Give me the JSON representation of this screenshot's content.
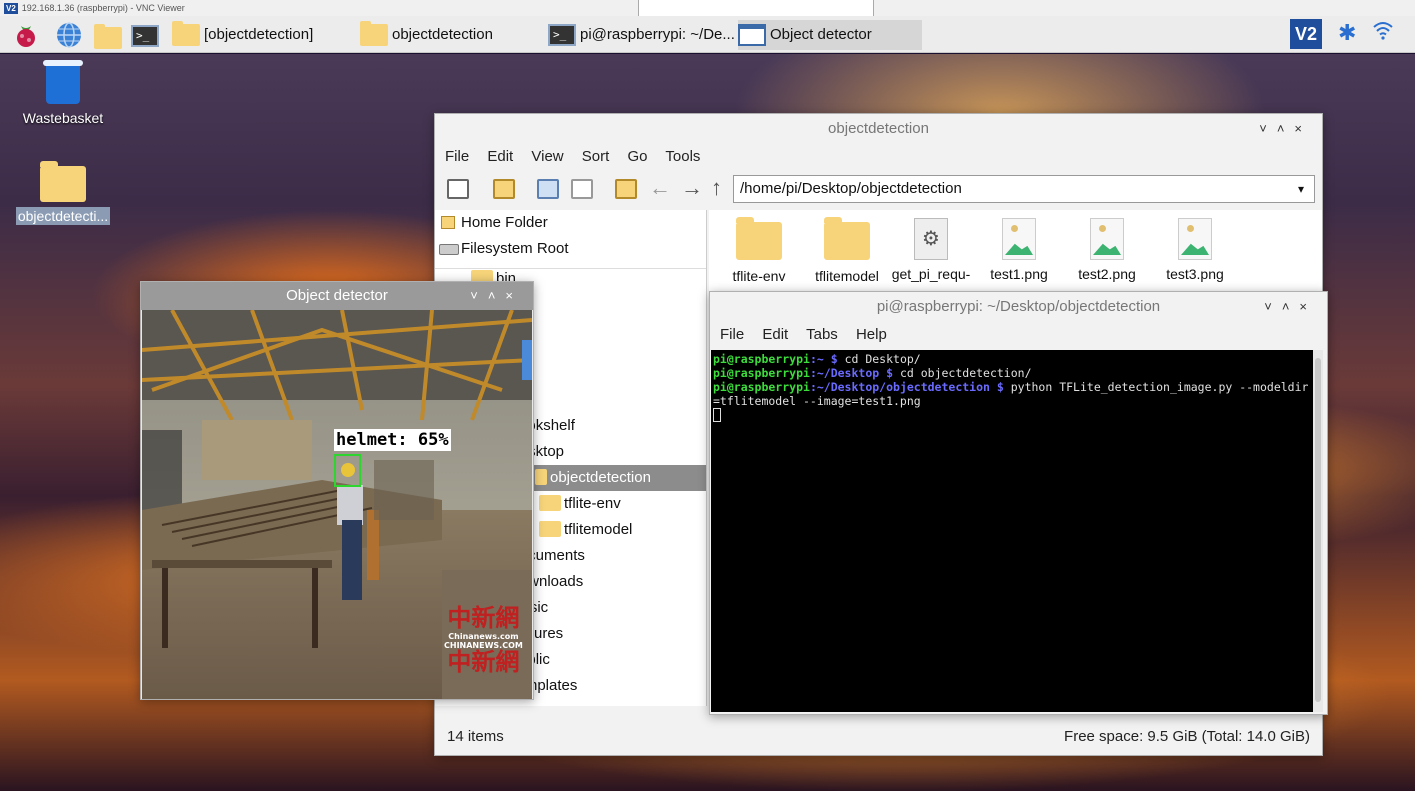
{
  "vnc": {
    "title": "192.168.1.36 (raspberrypi) - VNC Viewer",
    "logo": "V2"
  },
  "taskbar": {
    "launchers": [
      {
        "icon": "raspberry-icon"
      },
      {
        "icon": "globe-icon"
      },
      {
        "icon": "folder-icon"
      },
      {
        "icon": "terminal-icon"
      }
    ],
    "tasks": [
      {
        "label": "[objectdetection]",
        "icon": "folder-icon"
      },
      {
        "label": "objectdetection",
        "icon": "folder-icon"
      },
      {
        "label": "pi@raspberrypi: ~/De...",
        "icon": "terminal-icon"
      },
      {
        "label": "Object detector",
        "icon": "window-icon"
      }
    ],
    "tray": {
      "vnc_label": "V2",
      "bluetooth_icon": "bluetooth-icon",
      "wifi_icon": "wifi-icon"
    }
  },
  "desktop": {
    "icons": [
      {
        "label": "Wastebasket",
        "icon": "trash-icon"
      },
      {
        "label": "objectdetecti...",
        "icon": "folder-icon"
      }
    ]
  },
  "file_manager": {
    "title": "objectdetection",
    "menu": [
      "File",
      "Edit",
      "View",
      "Sort",
      "Go",
      "Tools"
    ],
    "path": "/home/pi/Desktop/objectdetection",
    "places": [
      "Home Folder",
      "Filesystem Root"
    ],
    "tree_partial": "bin",
    "tree": [
      {
        "label": "Bookshelf",
        "indent": 1,
        "selected": false
      },
      {
        "label": "Desktop",
        "indent": 1,
        "selected": false
      },
      {
        "label": "objectdetection",
        "indent": 2,
        "selected": true
      },
      {
        "label": "tflite-env",
        "indent": 3,
        "selected": false
      },
      {
        "label": "tflitemodel",
        "indent": 3,
        "selected": false
      },
      {
        "label": "Documents",
        "indent": 1,
        "selected": false
      },
      {
        "label": "Downloads",
        "indent": 1,
        "selected": false
      },
      {
        "label": "Music",
        "indent": 1,
        "selected": false
      },
      {
        "label": "Pictures",
        "indent": 1,
        "selected": false
      },
      {
        "label": "Public",
        "indent": 1,
        "selected": false
      },
      {
        "label": "Templates",
        "indent": 1,
        "selected": false
      }
    ],
    "files": [
      {
        "name": "tflite-env",
        "type": "folder"
      },
      {
        "name": "tflitemodel",
        "type": "folder"
      },
      {
        "name": "get_pi_requ-",
        "type": "script"
      },
      {
        "name": "test1.png",
        "type": "image"
      },
      {
        "name": "test2.png",
        "type": "image"
      },
      {
        "name": "test3.png",
        "type": "image"
      }
    ],
    "status_left": "14 items",
    "status_right": "Free space: 9.5 GiB (Total: 14.0 GiB)"
  },
  "terminal": {
    "title": "pi@raspberrypi: ~/Desktop/objectdetection",
    "menu": [
      "File",
      "Edit",
      "Tabs",
      "Help"
    ],
    "lines": [
      {
        "user": "pi@raspberrypi",
        "path": ":~ $",
        "cmd": " cd Desktop/"
      },
      {
        "user": "pi@raspberrypi",
        "path": ":~/Desktop $",
        "cmd": " cd objectdetection/"
      },
      {
        "user": "pi@raspberrypi",
        "path": ":~/Desktop/objectdetection $",
        "cmd": " python TFLite_detection_image.py --modeldir=tflitemodel --image=test1.png"
      }
    ]
  },
  "object_detector": {
    "title": "Object detector",
    "detection_label": "helmet: 65%",
    "watermark": [
      "中新網",
      "Chinanews.com",
      "CHINANEWS.COM",
      "中新網"
    ]
  },
  "controls": {
    "minimize": "˅",
    "maximize": "˄",
    "close": "×"
  }
}
